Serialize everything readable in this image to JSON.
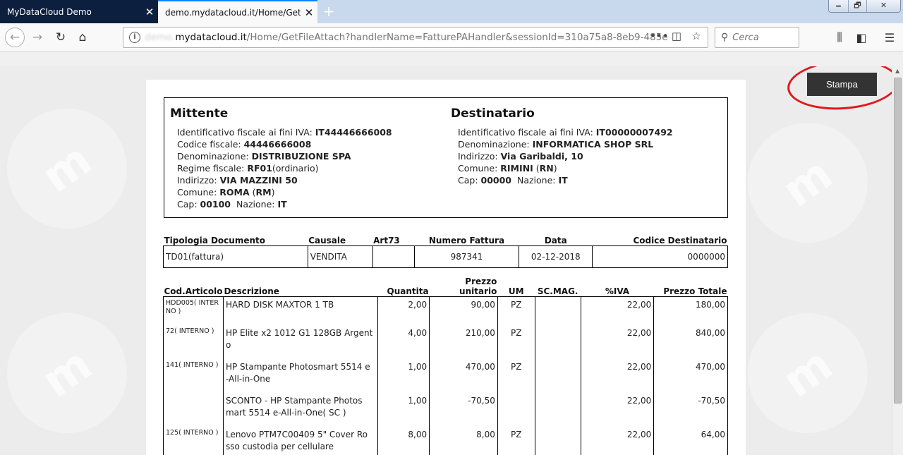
{
  "browser": {
    "tabs": [
      {
        "label": "MyDataCloud Demo",
        "active": false
      },
      {
        "label": "demo.mydatacloud.it/Home/GetFi",
        "active": true
      }
    ],
    "window_controls": {
      "minimize": "🗕",
      "maximize": "🗗",
      "close": "✕"
    },
    "url": {
      "blurred": "demo.",
      "host": "mydatacloud.it",
      "path": "/Home/GetFileAttach?handlerName=FatturePAHandler&sessionId=310a75a8-8eb9-485e"
    },
    "search_placeholder": "Cerca"
  },
  "print_button": "Stampa",
  "mittente": {
    "title": "Mittente",
    "lines": [
      {
        "label": "Identificativo fiscale ai fini IVA: ",
        "value": "IT44446666008",
        "suffix": ""
      },
      {
        "label": "Codice fiscale: ",
        "value": "44446666008",
        "suffix": ""
      },
      {
        "label": "Denominazione: ",
        "value": "DISTRIBUZIONE SPA",
        "suffix": ""
      },
      {
        "label": "Regime fiscale: ",
        "value": "RF01",
        "suffix": "(ordinario)"
      },
      {
        "label": "Indirizzo: ",
        "value": "VIA MAZZINI 50",
        "suffix": ""
      },
      {
        "label": "Comune: ",
        "value": "ROMA",
        "suffix": "",
        "prov": "RM"
      },
      {
        "label": "Cap: ",
        "value": "00100",
        "suffix": "",
        "nazione": "IT"
      }
    ]
  },
  "destinatario": {
    "title": "Destinatario",
    "lines": [
      {
        "label": "Identificativo fiscale ai fini IVA: ",
        "value": "IT00000007492",
        "suffix": ""
      },
      {
        "label": "Denominazione: ",
        "value": "INFORMATICA SHOP SRL",
        "suffix": ""
      },
      {
        "label": "Indirizzo: ",
        "value": "Via Garibaldi, 10",
        "suffix": ""
      },
      {
        "label": "Comune: ",
        "value": "RIMINI",
        "suffix": "",
        "prov": "RN"
      },
      {
        "label": "Cap: ",
        "value": "00000",
        "suffix": "",
        "nazione": "IT"
      }
    ]
  },
  "nazione_label": "Nazione: ",
  "documento": {
    "headers": [
      "Tipologia Documento",
      "Causale",
      "Art73",
      "Numero Fattura",
      "Data",
      "Codice Destinatario"
    ],
    "row": [
      "TD01(fattura)",
      "VENDITA",
      "",
      "987341",
      "02-12-2018",
      "0000000"
    ]
  },
  "righe": {
    "headers": [
      "Cod.Articolo",
      "Descrizione",
      "Quantita",
      "Prezzo unitario",
      "UM",
      "SC.MAG.",
      "%IVA",
      "Prezzo Totale"
    ],
    "rows": [
      [
        "HDD005( INTER NO )",
        "HARD DISK MAXTOR 1 TB",
        "2,00",
        "90,00",
        "PZ",
        "",
        "22,00",
        "180,00"
      ],
      [
        "72( INTERNO )",
        "HP Elite x2 1012 G1 128GB Argent o",
        "4,00",
        "210,00",
        "PZ",
        "",
        "22,00",
        "840,00"
      ],
      [
        "141( INTERNO )",
        "HP Stampante Photosmart 5514 e -All-in-One",
        "1,00",
        "470,00",
        "PZ",
        "",
        "22,00",
        "470,00"
      ],
      [
        "",
        "SCONTO - HP Stampante Photos mart 5514 e-All-in-One( SC )",
        "1,00",
        "-70,50",
        "",
        "",
        "22,00",
        "-70,50"
      ],
      [
        "125( INTERNO )",
        "Lenovo PTM7C00409 5\" Cover Ro sso custodia per cellulare",
        "8,00",
        "8,00",
        "PZ",
        "",
        "22,00",
        "64,00"
      ]
    ]
  }
}
